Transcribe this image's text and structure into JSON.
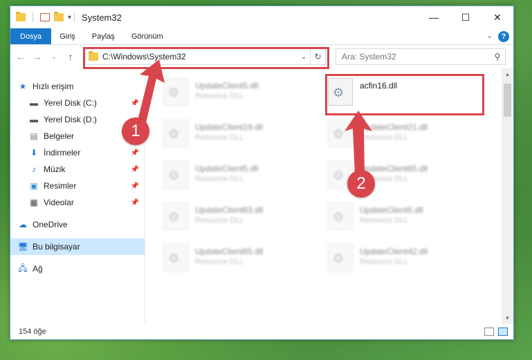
{
  "window": {
    "title": "System32",
    "controls": {
      "minimize": "—",
      "maximize": "☐",
      "close": "✕"
    }
  },
  "ribbon": {
    "tabs": [
      "Dosya",
      "Giriş",
      "Paylaş",
      "Görünüm"
    ],
    "help": "?"
  },
  "address": {
    "path": "C:\\Windows\\System32",
    "search_placeholder": "Ara: System32"
  },
  "sidebar": {
    "items": [
      {
        "label": "Hızlı erişim",
        "icon": "star-icon",
        "pinned": false
      },
      {
        "label": "Yerel Disk (C:)",
        "icon": "drive-icon",
        "pinned": true
      },
      {
        "label": "Yerel Disk (D:)",
        "icon": "drive-icon",
        "pinned": false
      },
      {
        "label": "Belgeler",
        "icon": "documents-icon",
        "pinned": true
      },
      {
        "label": "İndirmeler",
        "icon": "download-icon",
        "pinned": true
      },
      {
        "label": "Müzik",
        "icon": "music-icon",
        "pinned": true
      },
      {
        "label": "Resimler",
        "icon": "pictures-icon",
        "pinned": true
      },
      {
        "label": "Videolar",
        "icon": "video-icon",
        "pinned": true
      },
      {
        "label": "OneDrive",
        "icon": "cloud-icon",
        "pinned": false
      },
      {
        "label": "Bu bilgisayar",
        "icon": "computer-icon",
        "pinned": false
      },
      {
        "label": "Ağ",
        "icon": "network-icon",
        "pinned": false
      }
    ]
  },
  "files": {
    "highlighted": {
      "name": "acfin16.dll",
      "type": ""
    },
    "blurred": [
      {
        "name": "UpdateClient5.dll",
        "type": "Resource DLL"
      },
      {
        "name": "UpdateClient19.dll",
        "type": "Resource DLL"
      },
      {
        "name": "UpdateClient21.dll",
        "type": "Resource DLL"
      },
      {
        "name": "UpdateClient5.dll",
        "type": "Resource DLL"
      },
      {
        "name": "UpdateClient65.dll",
        "type": "Resource DLL"
      },
      {
        "name": "UpdateClient63.dll",
        "type": "Resource DLL"
      },
      {
        "name": "UpdateClient5.dll",
        "type": "Resource DLL"
      },
      {
        "name": "UpdateClient65.dll",
        "type": "Resource DLL"
      },
      {
        "name": "UpdateClient42.dll",
        "type": "Resource DLL"
      }
    ]
  },
  "status": {
    "count": "154 öğe"
  },
  "markers": {
    "one": "1",
    "two": "2"
  },
  "colors": {
    "accent": "#1979ca",
    "highlight": "#d9454c",
    "selected": "#cce8ff"
  }
}
